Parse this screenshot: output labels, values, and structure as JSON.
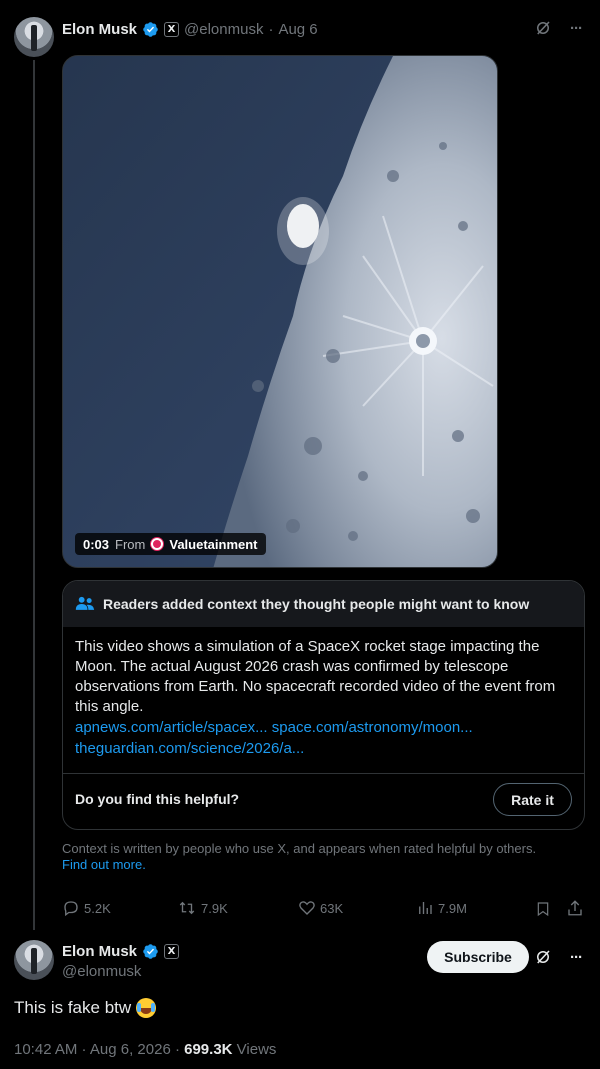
{
  "tweet": {
    "author_name": "Elon Musk",
    "x_badge": "X",
    "handle": "@elonmusk",
    "date": "Aug 6",
    "separator": "·",
    "more_label": "···"
  },
  "video": {
    "time": "0:03",
    "from_label": "From",
    "source": "Valuetainment"
  },
  "community_note": {
    "title": "Readers added context they thought people might want to know",
    "body": "This video shows a simulation of a SpaceX rocket stage impacting the Moon. The actual August 2026 crash was confirmed by telescope observations from Earth. No spacecraft recorded video of the event from this angle.",
    "links": [
      "apnews.com/article/spacex...",
      "space.com/astronomy/moon...",
      "theguardian.com/science/2026/a..."
    ],
    "question": "Do you find this helpful?",
    "rate_button": "Rate it",
    "disclaimer": "Context is written by people who use X, and appears when rated helpful by others.",
    "find_out_more": "Find out more."
  },
  "actions": {
    "replies": "5.2K",
    "reposts": "7.9K",
    "likes": "63K",
    "views": "7.9M"
  },
  "reply": {
    "author_name": "Elon Musk",
    "x_badge": "X",
    "handle": "@elonmusk",
    "subscribe_label": "Subscribe",
    "more_label": "···",
    "text": "This is fake btw",
    "emoji": "face-with-tears-of-joy",
    "time": "10:42 AM · Aug 6, 2026 ·",
    "view_count": "699.3K",
    "views_label": "Views"
  },
  "colors": {
    "background": "#000000",
    "accent_link": "#1d9bf0",
    "verified": "#1d9bf0",
    "muted": "#71767b"
  }
}
